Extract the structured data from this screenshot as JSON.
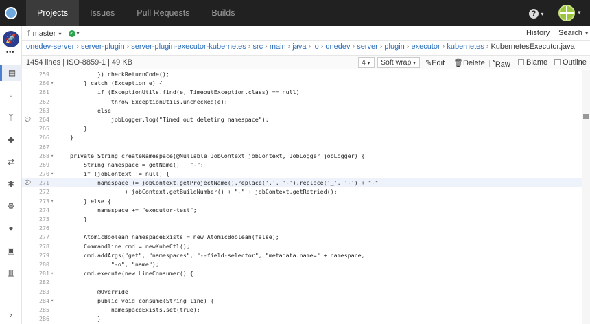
{
  "topnav": {
    "items": [
      "Projects",
      "Issues",
      "Pull Requests",
      "Builds"
    ]
  },
  "toolbar": {
    "branch": "master",
    "history": "History",
    "search": "Search"
  },
  "breadcrumb": [
    "onedev-server",
    "server-plugin",
    "server-plugin-executor-kubernetes",
    "src",
    "main",
    "java",
    "io",
    "onedev",
    "server",
    "plugin",
    "executor",
    "kubernetes",
    "KubernetesExecutor.java"
  ],
  "fileinfo": "1454 lines | ISO-8859-1 | 49 KB",
  "viewer": {
    "tab_size": "4",
    "wrap": "Soft wrap",
    "edit": "Edit",
    "delete": "Delete",
    "raw": "Raw",
    "blame": "Blame",
    "outline": "Outline"
  },
  "code_lines": [
    {
      "n": "259",
      "t": "            }).checkReturnCode();"
    },
    {
      "n": "260",
      "t": "        } catch (Exception e) {",
      "fold": true
    },
    {
      "n": "261",
      "t": "            if (ExceptionUtils.find(e, TimeoutException.class) == null)"
    },
    {
      "n": "262",
      "t": "                throw ExceptionUtils.unchecked(e);"
    },
    {
      "n": "263",
      "t": "            else"
    },
    {
      "n": "264",
      "t": "                jobLogger.log(\"Timed out deleting namespace\");",
      "comment": true
    },
    {
      "n": "265",
      "t": "        }"
    },
    {
      "n": "266",
      "t": "    }"
    },
    {
      "n": "267",
      "t": ""
    },
    {
      "n": "268",
      "t": "    private String createNamespace(@Nullable JobContext jobContext, JobLogger jobLogger) {",
      "fold": true
    },
    {
      "n": "269",
      "t": "        String namespace = getName() + \"-\";"
    },
    {
      "n": "270",
      "t": "        if (jobContext != null) {",
      "fold": true
    },
    {
      "n": "271",
      "t": "            namespace += jobContext.getProjectName().replace('.', '-').replace('_', '-') + \"-\"",
      "hl": true,
      "comment": true
    },
    {
      "n": "272",
      "t": "                    + jobContext.getBuildNumber() + \"-\" + jobContext.getRetried();"
    },
    {
      "n": "273",
      "t": "        } else {",
      "fold": true
    },
    {
      "n": "274",
      "t": "            namespace += \"executor-test\";"
    },
    {
      "n": "275",
      "t": "        }"
    },
    {
      "n": "276",
      "t": ""
    },
    {
      "n": "277",
      "t": "        AtomicBoolean namespaceExists = new AtomicBoolean(false);"
    },
    {
      "n": "278",
      "t": "        Commandline cmd = newKubeCtl();"
    },
    {
      "n": "279",
      "t": "        cmd.addArgs(\"get\", \"namespaces\", \"--field-selector\", \"metadata.name=\" + namespace,"
    },
    {
      "n": "280",
      "t": "                \"-o\", \"name\");"
    },
    {
      "n": "281",
      "t": "        cmd.execute(new LineConsumer() {",
      "fold": true
    },
    {
      "n": "282",
      "t": ""
    },
    {
      "n": "283",
      "t": "            @Override"
    },
    {
      "n": "284",
      "t": "            public void consume(String line) {",
      "fold": true
    },
    {
      "n": "285",
      "t": "                namespaceExists.set(true);"
    },
    {
      "n": "286",
      "t": "            }"
    }
  ]
}
